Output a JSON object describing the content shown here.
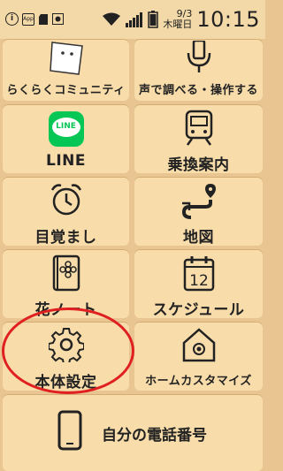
{
  "status_bar": {
    "date": "9/3",
    "weekday": "木曜日",
    "time": "10:15",
    "app_badge": "App"
  },
  "tiles": {
    "community": "らくらくコミュニティ",
    "voice": "声で調べる・操作する",
    "line_label": "LINE",
    "line_icon_text": "LINE",
    "transit": "乗換案内",
    "alarm": "目覚まし",
    "map": "地図",
    "flower_note": "花ノート",
    "schedule": "スケジュール",
    "calendar_day": "12",
    "settings": "本体設定",
    "home_customize": "ホームカスタマイズ",
    "phone_number": "自分の電話番号"
  },
  "colors": {
    "background": "#e9c591",
    "tile": "#f8dcaa",
    "line_green": "#06c755",
    "highlight_circle": "#e02020"
  }
}
